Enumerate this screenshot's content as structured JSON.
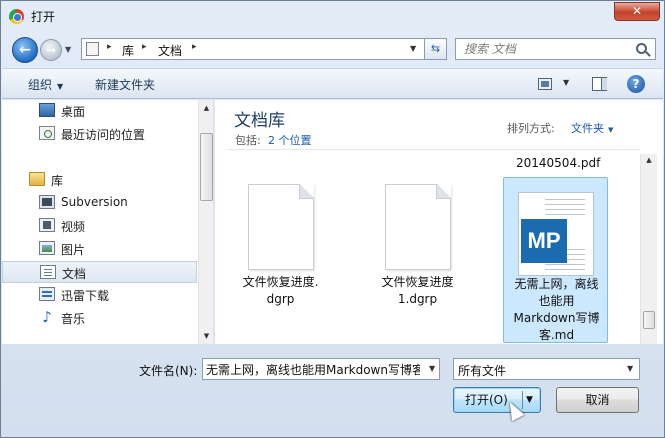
{
  "window": {
    "title": "打开",
    "close_label": "✕"
  },
  "nav": {
    "back_arrow": "←",
    "forward_arrow": "→"
  },
  "address": {
    "crumbs": [
      "库",
      "文档"
    ],
    "separator": "▸"
  },
  "search": {
    "placeholder": "搜索 文档"
  },
  "toolbar": {
    "organize": "组织",
    "new_folder": "新建文件夹",
    "help": "?"
  },
  "sidebar": {
    "items": [
      {
        "label": "桌面",
        "icon": "desktop-icon"
      },
      {
        "label": "最近访问的位置",
        "icon": "recent-places-icon"
      },
      {
        "label": "库",
        "icon": "library-icon"
      },
      {
        "label": "Subversion",
        "icon": "subversion-icon"
      },
      {
        "label": "视频",
        "icon": "video-icon"
      },
      {
        "label": "图片",
        "icon": "pictures-icon"
      },
      {
        "label": "文档",
        "icon": "documents-icon",
        "selected": true
      },
      {
        "label": "迅雷下载",
        "icon": "thunder-download-icon"
      },
      {
        "label": "音乐",
        "icon": "music-icon"
      }
    ]
  },
  "library": {
    "title": "文档库",
    "includes_label": "包括:",
    "includes_link": "2 个位置",
    "arrange_label": "排列方式:",
    "arrange_value": "文件夹"
  },
  "files": {
    "partial_name": "20140504.pdf",
    "items": [
      {
        "name_line1": "文件恢复进度.",
        "name_line2": "dgrp"
      },
      {
        "name_line1": "文件恢复进度",
        "name_line2": "1.dgrp"
      },
      {
        "name_line1": "无需上网，离线",
        "name_line2": "也能用",
        "name_line3": "Markdown写博",
        "name_line4": "客.md",
        "badge": "MP",
        "selected": true
      }
    ]
  },
  "footer": {
    "filename_label": "文件名(N):",
    "filename_value": "无需上网，离线也能用Markdown写博客",
    "filetype_value": "所有文件",
    "open_label": "打开(O)",
    "cancel_label": "取消"
  },
  "colors": {
    "accent": "#1a5bb0",
    "selection": "#cce8ff",
    "md_badge": "#1a6bb0"
  }
}
